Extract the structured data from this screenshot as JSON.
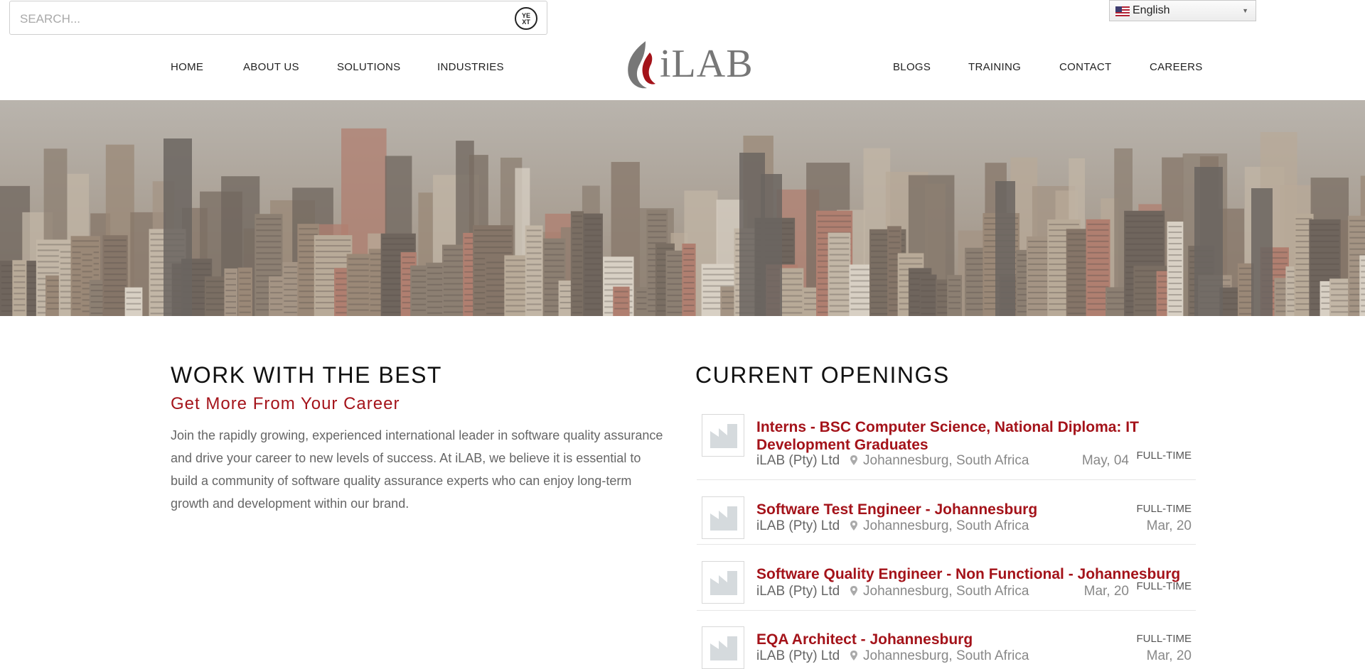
{
  "search": {
    "placeholder": "SEARCH...",
    "icon": "yext-icon",
    "icon_text": "YEXT"
  },
  "language": {
    "selected": "English",
    "flag": "us-flag-icon"
  },
  "nav": {
    "left": [
      "HOME",
      "ABOUT US",
      "SOLUTIONS",
      "INDUSTRIES"
    ],
    "right": [
      "BLOGS",
      "TRAINING",
      "CONTACT",
      "CAREERS"
    ]
  },
  "logo": {
    "text": "iLAB",
    "colors": {
      "flame": "#a4131a",
      "text": "#777777"
    }
  },
  "hero": {
    "alt": "city skyline"
  },
  "work": {
    "title": "WORK WITH THE BEST",
    "subtitle": "Get More From Your Career",
    "body": "Join the rapidly growing, experienced international leader in software quality assurance and drive your career to new levels of success.  At iLAB, we believe it is essential to build a community of software quality assurance experts who can enjoy long-term growth and development within our brand."
  },
  "openings": {
    "title": "CURRENT OPENINGS",
    "jobs": [
      {
        "title": "Interns - BSC Computer Science, National Diploma: IT Development Graduates",
        "company": "iLAB (Pty) Ltd",
        "location": "Johannesburg, South Africa",
        "date": "May, 04",
        "type": "FULL-TIME"
      },
      {
        "title": "Software Test Engineer - Johannesburg",
        "company": "iLAB (Pty) Ltd",
        "location": "Johannesburg, South Africa",
        "date": "Mar, 20",
        "type": "FULL-TIME"
      },
      {
        "title": "Software Quality Engineer - Non Functional - Johannesburg",
        "company": "iLAB (Pty) Ltd",
        "location": "Johannesburg, South Africa",
        "date": "Mar, 20",
        "type": "FULL-TIME"
      },
      {
        "title": "EQA Architect - Johannesburg",
        "company": "iLAB (Pty) Ltd",
        "location": "Johannesburg, South Africa",
        "date": "Mar, 20",
        "type": "FULL-TIME"
      }
    ]
  },
  "colors": {
    "accent": "#a4131a",
    "text": "#333333",
    "muted": "#888888"
  }
}
